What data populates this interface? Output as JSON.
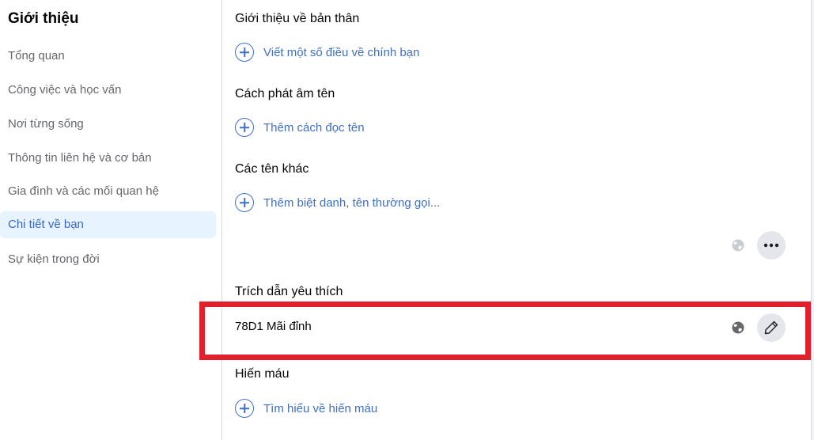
{
  "sidebar": {
    "title": "Giới thiệu",
    "items": [
      {
        "label": "Tổng quan",
        "active": false
      },
      {
        "label": "Công việc và học vấn",
        "active": false
      },
      {
        "label": "Nơi từng sống",
        "active": false
      },
      {
        "label": "Thông tin liên hệ và cơ bản",
        "active": false
      },
      {
        "label": "Gia đình và các mối quan hệ",
        "active": false
      },
      {
        "label": "Chi tiết về bạn",
        "active": true
      },
      {
        "label": "Sự kiện trong đời",
        "active": false
      }
    ]
  },
  "main": {
    "sections": {
      "about": {
        "title": "Giới thiệu về bản thân",
        "action": "Viết một số điều về chính bạn",
        "icon": "plus-circle-icon"
      },
      "pronunciation": {
        "title": "Cách phát âm tên",
        "action": "Thêm cách đọc tên",
        "icon": "plus-circle-icon"
      },
      "other_names": {
        "title": "Các tên khác",
        "action": "Thêm biệt danh, tên thường gọi...",
        "icon": "plus-circle-icon",
        "privacy_icon": "globe-icon",
        "more_button": "more-options-icon"
      },
      "favorite_quotes": {
        "title": "Trích dẫn yêu thích",
        "value": "78D1 Mãi đỉnh",
        "privacy_icon": "globe-icon",
        "edit_button": "pencil-icon",
        "highlighted": true
      },
      "blood_donation": {
        "title": "Hiến máu",
        "action": "Tìm hiểu về hiến máu",
        "icon": "plus-circle-icon"
      }
    }
  },
  "colors": {
    "accent": "#3f6fc6",
    "active_bg": "#e7f3ff",
    "highlight_box": "#e0202c",
    "button_bg": "#e4e6eb"
  }
}
